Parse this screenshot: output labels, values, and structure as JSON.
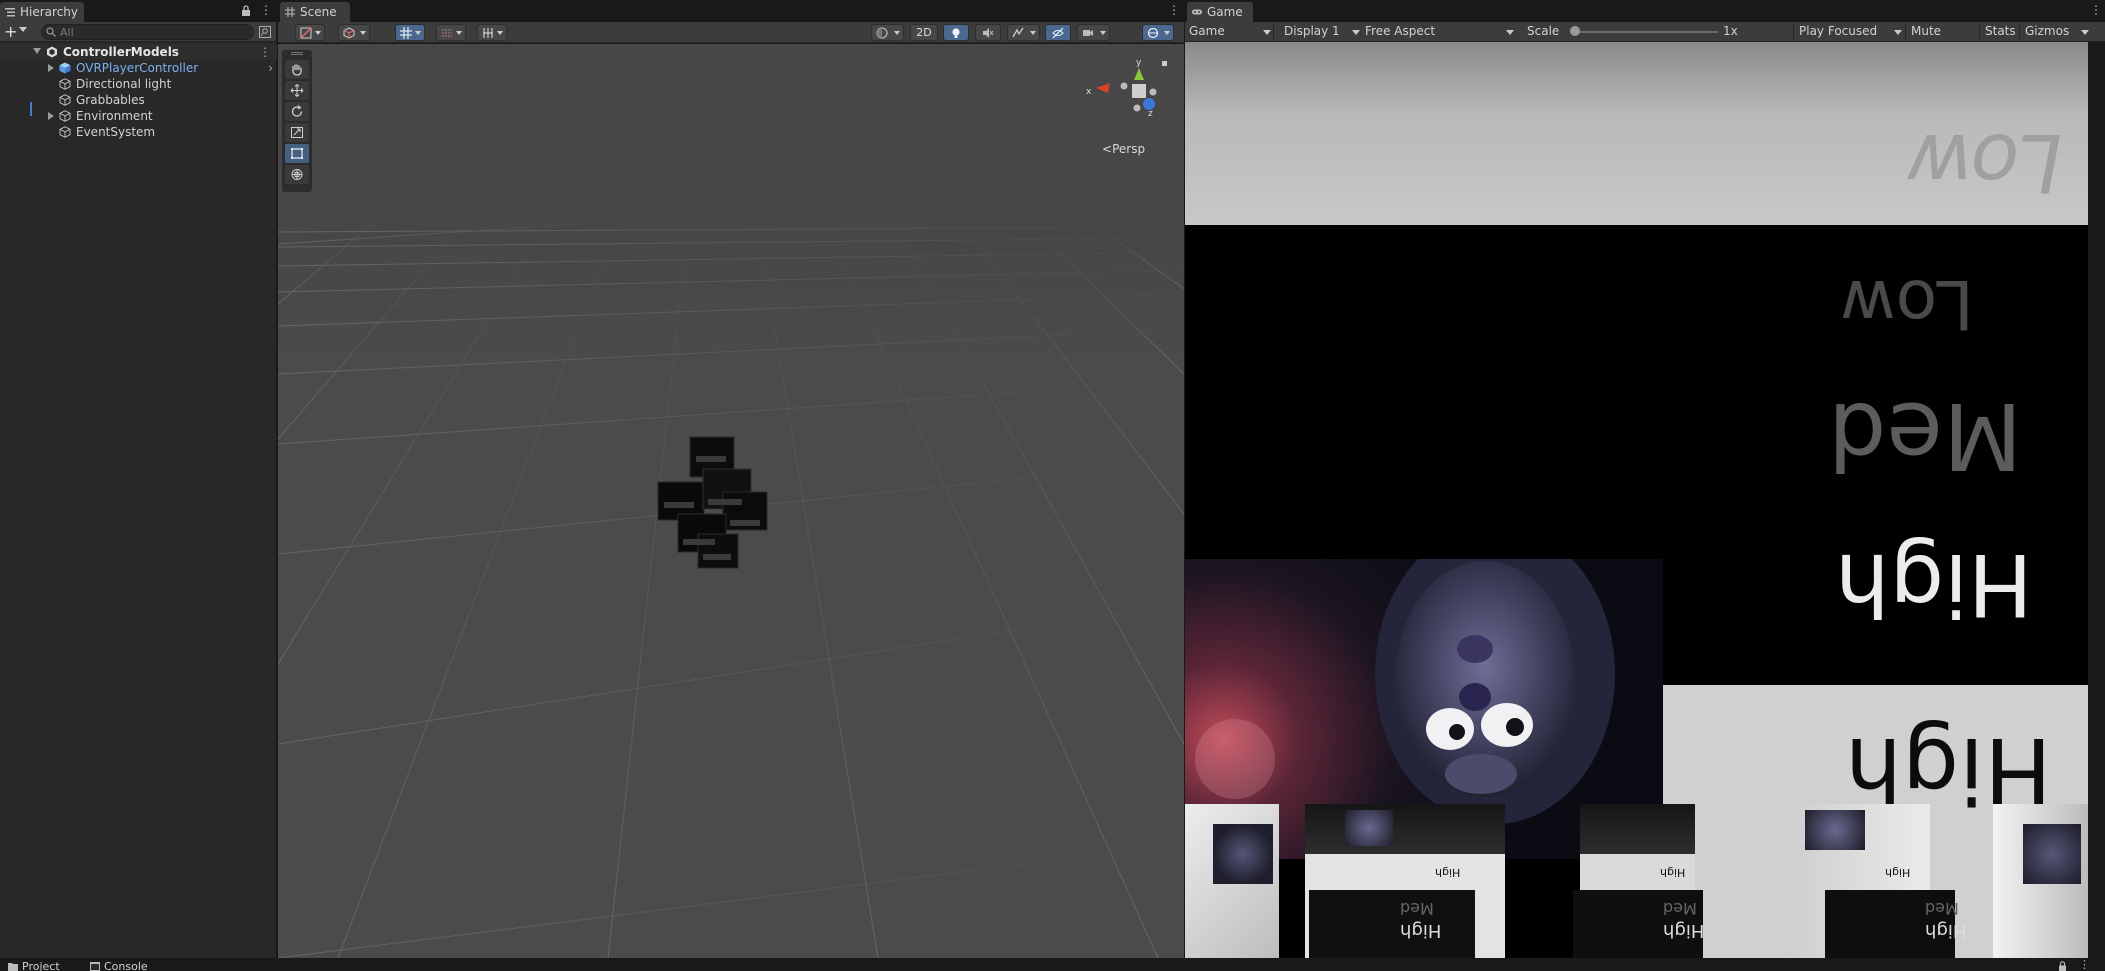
{
  "hierarchy": {
    "tab_label": "Hierarchy",
    "search_placeholder": "All",
    "scene_name": "ControllerModels",
    "items": [
      {
        "label": "OVRPlayerController",
        "type": "prefab",
        "expandable": true
      },
      {
        "label": "Directional light",
        "type": "gameobject",
        "expandable": false
      },
      {
        "label": "Grabbables",
        "type": "gameobject",
        "expandable": false
      },
      {
        "label": "Environment",
        "type": "gameobject",
        "expandable": true
      },
      {
        "label": "EventSystem",
        "type": "gameobject",
        "expandable": false
      }
    ]
  },
  "scene": {
    "tab_label": "Scene",
    "mode_2d_label": "2D",
    "persp_label": "Persp",
    "gizmo_axes": {
      "y": "y",
      "x": "x",
      "z": "z"
    },
    "tools": [
      "hand-tool",
      "move-tool",
      "rotate-tool",
      "scale-tool",
      "rect-tool",
      "transform-tool"
    ],
    "active_tool": "rect-tool"
  },
  "game": {
    "tab_label": "Game",
    "view_dropdown": "Game",
    "display_dropdown": "Display 1",
    "aspect_dropdown": "Free Aspect",
    "scale_label": "Scale",
    "scale_value": "1x",
    "play_mode_dropdown": "Play Focused",
    "mute_label": "Mute Audio",
    "stats_label": "Stats",
    "gizmos_label": "Gizmos",
    "view_text": {
      "low_top": "Low",
      "low": "Low",
      "med": "Med",
      "high_dark": "High",
      "high_light": "High",
      "cube_high": "High",
      "cube_med": "Med"
    }
  },
  "bottom": {
    "project_tab": "Project",
    "console_tab": "Console"
  },
  "colors": {
    "prefab_text": "#7cb1ef",
    "selection_accent": "#4a6890"
  }
}
